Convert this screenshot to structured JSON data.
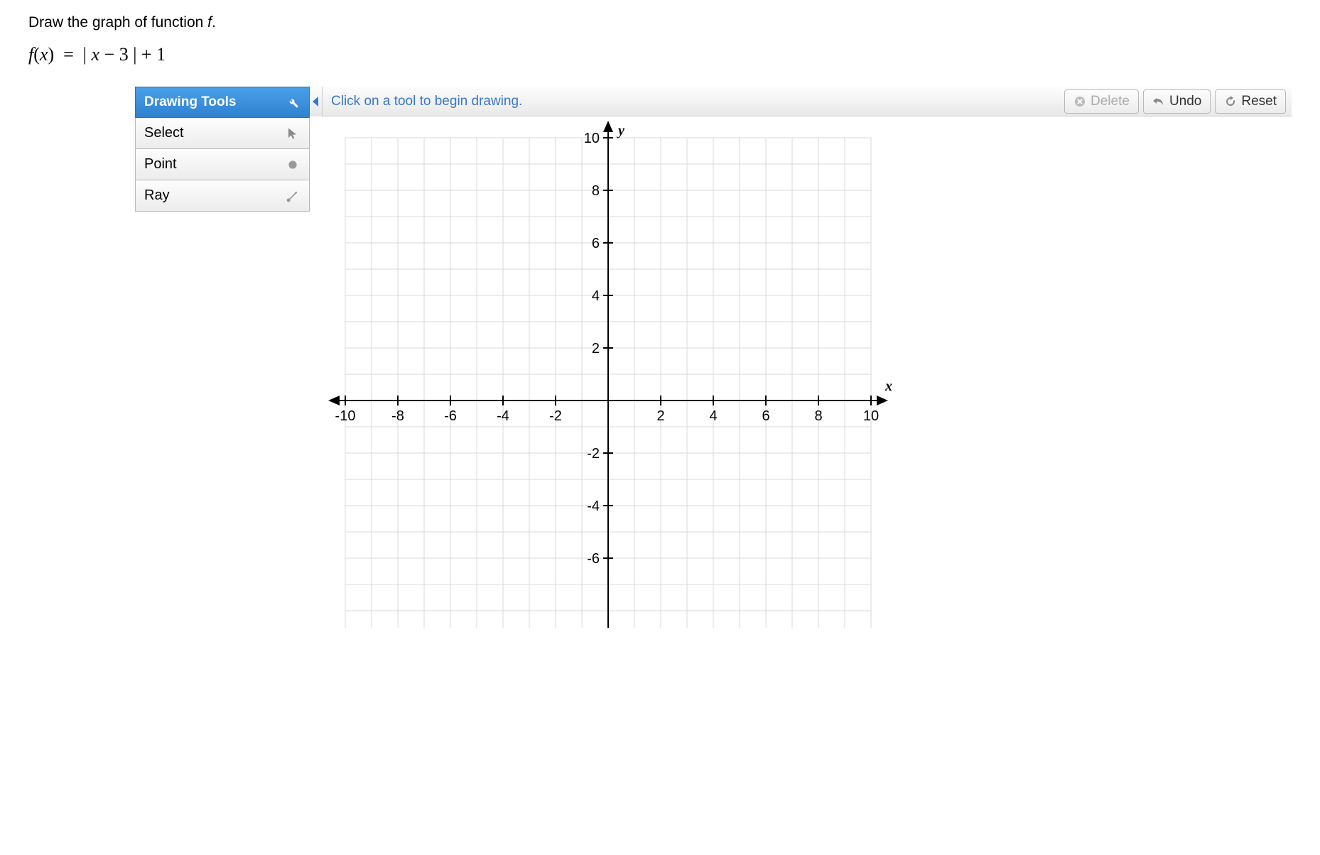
{
  "prompt": "Draw the graph of function f.",
  "formula_plain": "f(x) = | x − 3 | + 1",
  "sidebar": {
    "header": "Drawing Tools",
    "tools": [
      {
        "label": "Select",
        "icon": "cursor-icon"
      },
      {
        "label": "Point",
        "icon": "point-icon"
      },
      {
        "label": "Ray",
        "icon": "ray-icon"
      }
    ]
  },
  "topbar": {
    "hint": "Click on a tool to begin drawing.",
    "delete": "Delete",
    "undo": "Undo",
    "reset": "Reset"
  },
  "chart_data": {
    "type": "grid",
    "xlabel": "x",
    "ylabel": "y",
    "xlim": [
      -10,
      10
    ],
    "ylim": [
      -10,
      10
    ],
    "xticks": [
      -10,
      -8,
      -6,
      -4,
      -2,
      2,
      4,
      6,
      8,
      10
    ],
    "yticks": [
      -6,
      -4,
      -2,
      2,
      4,
      6,
      8,
      10
    ],
    "grid_step": 1
  }
}
